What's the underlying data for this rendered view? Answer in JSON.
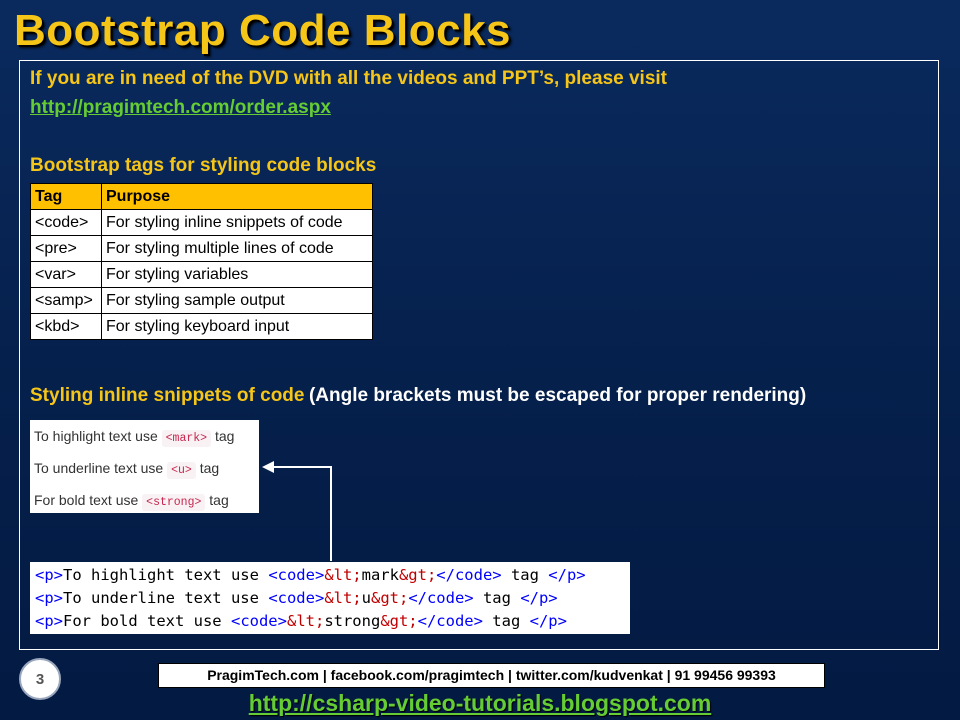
{
  "title": "Bootstrap Code Blocks",
  "intro": {
    "text": "If you are in need of the DVD with all the videos and PPT’s, please visit",
    "link": "http://pragimtech.com/order.aspx"
  },
  "table_section": {
    "heading": "Bootstrap tags for styling code blocks",
    "headers": [
      "Tag",
      "Purpose"
    ],
    "rows": [
      [
        "<code>",
        "For styling inline snippets of code"
      ],
      [
        "<pre>",
        "For styling multiple lines of code"
      ],
      [
        "<var>",
        "For styling variables"
      ],
      [
        "<samp>",
        "For styling sample output"
      ],
      [
        "<kbd>",
        "For styling keyboard input"
      ]
    ]
  },
  "inline_section": {
    "heading": "Styling inline snippets of code",
    "note": "(Angle brackets must be escaped for proper rendering)"
  },
  "rendered_output": [
    {
      "before": "To highlight text use",
      "code": "<mark>",
      "after": "tag"
    },
    {
      "before": "To underline text use",
      "code": "<u>",
      "after": "tag"
    },
    {
      "before": "For bold text use",
      "code": "<strong>",
      "after": "tag"
    }
  ],
  "source_code": [
    {
      "open_p": "<p>",
      "text": "To highlight text use ",
      "open_code": "<code>",
      "ent_lt": "&lt;",
      "word": "mark",
      "ent_gt": "&gt;",
      "close_code": "</code>",
      "tail": " tag ",
      "close_p": "</p>"
    },
    {
      "open_p": "<p>",
      "text": "To underline text use ",
      "open_code": "<code>",
      "ent_lt": "&lt;",
      "word": "u",
      "ent_gt": "&gt;",
      "close_code": "</code>",
      "tail": " tag ",
      "close_p": "</p>"
    },
    {
      "open_p": "<p>",
      "text": "For bold text use ",
      "open_code": "<code>",
      "ent_lt": "&lt;",
      "word": "strong",
      "ent_gt": "&gt;",
      "close_code": "</code>",
      "tail": " tag ",
      "close_p": "</p>"
    }
  ],
  "page_number": "3",
  "footer": {
    "contact": "PragimTech.com | facebook.com/pragimtech | twitter.com/kudvenkat | 91 99456 99393",
    "url": "http://csharp-video-tutorials.blogspot.com"
  },
  "colors": {
    "title": "#f5c518",
    "link": "#66cc33",
    "table_header": "#ffc000",
    "background": "#06214e"
  }
}
